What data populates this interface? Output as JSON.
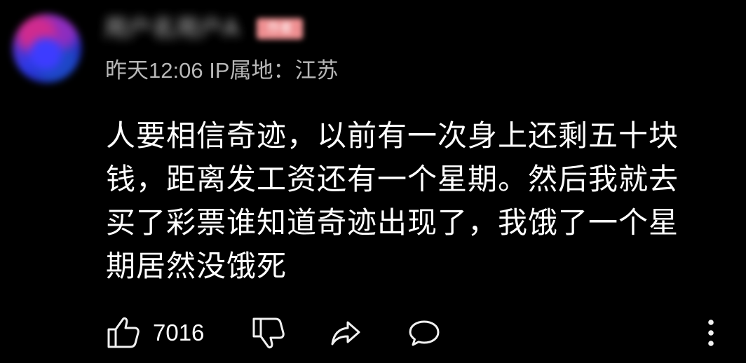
{
  "comment": {
    "username": "用户名用户A",
    "badge": "作者",
    "meta": "昨天12:06 IP属地：江苏",
    "content_lines": [
      "人要相信奇迹，以前有一次身上还剩五十块",
      "钱，距离发工资还有一个星期。然后我就去",
      "买了彩票谁知道奇迹出现了，我饿了一个星",
      "期居然没饿死"
    ],
    "like_count": "7016"
  },
  "icons": {
    "avatar": "blurred-avatar",
    "like": "thumbs-up-icon",
    "dislike": "thumbs-down-icon",
    "share": "share-arrow-icon",
    "reply": "comment-bubble-icon",
    "more": "more-vertical-icon"
  },
  "colors": {
    "background": "#000000",
    "primary_text": "#ffffff",
    "secondary_text": "#b7b7b7",
    "badge": "#ef8f91",
    "avatar_blue": "#3d3cff",
    "avatar_magenta": "#cf2b8f"
  }
}
